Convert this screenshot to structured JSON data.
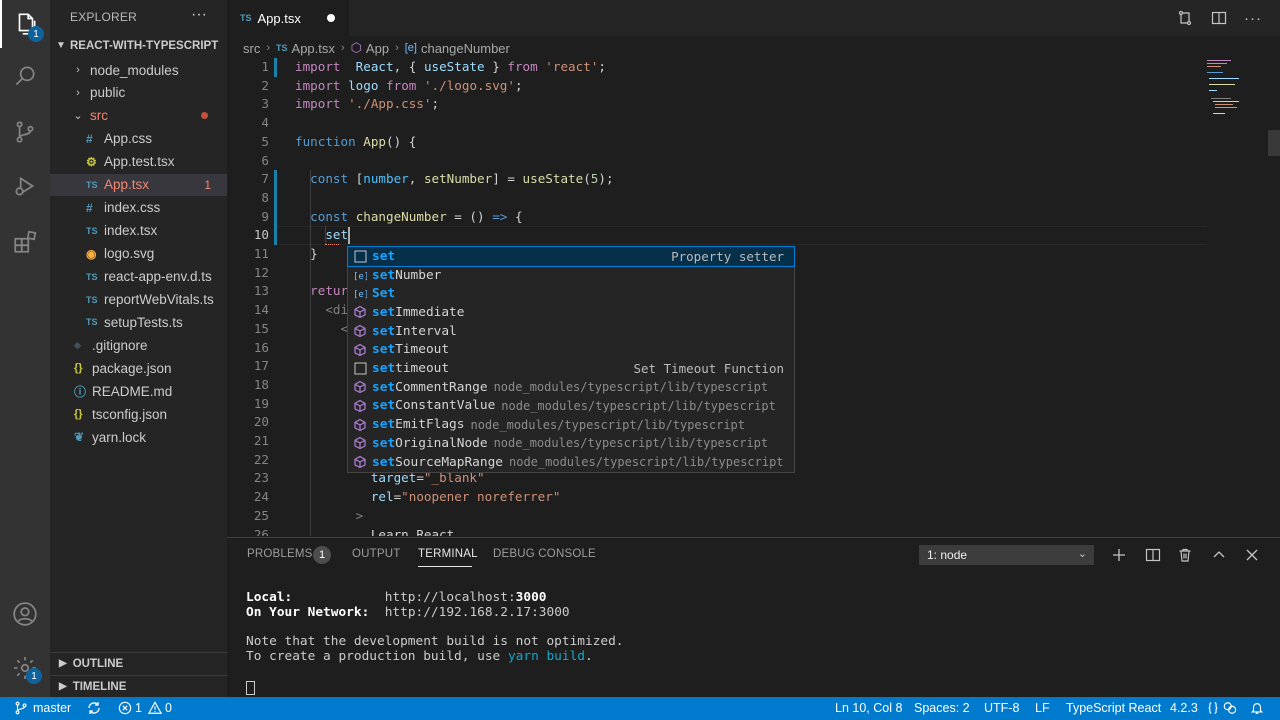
{
  "activity_bar": {
    "explorer_badge": "1",
    "settings_badge": "1"
  },
  "sidebar": {
    "title": "EXPLORER",
    "more": "···",
    "folder": "REACT-WITH-TYPESCRIPT",
    "items": [
      {
        "label": "node_modules",
        "type": "folder-closed",
        "color": "#cccccc"
      },
      {
        "label": "public",
        "type": "folder-closed",
        "color": "#cccccc"
      },
      {
        "label": "src",
        "type": "folder-open",
        "color": "#f48771"
      },
      {
        "label": "App.css",
        "type": "css"
      },
      {
        "label": "App.test.tsx",
        "type": "test"
      },
      {
        "label": "App.tsx",
        "type": "ts",
        "badge": "1",
        "color": "#f48771"
      },
      {
        "label": "index.css",
        "type": "css"
      },
      {
        "label": "index.tsx",
        "type": "ts"
      },
      {
        "label": "logo.svg",
        "type": "svg"
      },
      {
        "label": "react-app-env.d.ts",
        "type": "ts"
      },
      {
        "label": "reportWebVitals.ts",
        "type": "ts"
      },
      {
        "label": "setupTests.ts",
        "type": "ts"
      },
      {
        "label": ".gitignore",
        "type": "git"
      },
      {
        "label": "package.json",
        "type": "json"
      },
      {
        "label": "README.md",
        "type": "info"
      },
      {
        "label": "tsconfig.json",
        "type": "json"
      },
      {
        "label": "yarn.lock",
        "type": "yarn"
      }
    ],
    "ts_badge": "TS",
    "outline": "OUTLINE",
    "timeline": "TIMELINE"
  },
  "tab": {
    "prefix": "TS",
    "label": "App.tsx"
  },
  "breadcrumb": {
    "parts": [
      "src",
      "App.tsx",
      "App",
      "changeNumber"
    ],
    "ts": "TS"
  },
  "editor": {
    "current_line": 10,
    "lines": [
      {
        "n": "1",
        "tokens": [
          [
            "kw2",
            "import"
          ],
          [
            "",
            "  "
          ],
          [
            "var",
            "React"
          ],
          [
            "",
            ", { "
          ],
          [
            "var",
            "useState"
          ],
          [
            "",
            " } "
          ],
          [
            "kw2",
            "from"
          ],
          [
            "",
            " "
          ],
          [
            "str",
            "'react'"
          ],
          [
            "",
            ";"
          ]
        ]
      },
      {
        "n": "2",
        "tokens": [
          [
            "kw2",
            "import"
          ],
          [
            "",
            " "
          ],
          [
            "var",
            "logo"
          ],
          [
            "",
            " "
          ],
          [
            "kw2",
            "from"
          ],
          [
            "",
            " "
          ],
          [
            "str",
            "'./logo.svg'"
          ],
          [
            "",
            ";"
          ]
        ]
      },
      {
        "n": "3",
        "tokens": [
          [
            "kw2",
            "import"
          ],
          [
            "",
            " "
          ],
          [
            "str",
            "'./App.css'"
          ],
          [
            "",
            ";"
          ]
        ]
      },
      {
        "n": "4",
        "tokens": []
      },
      {
        "n": "5",
        "tokens": [
          [
            "kw",
            "function"
          ],
          [
            "",
            " "
          ],
          [
            "fn",
            "App"
          ],
          [
            "",
            "() {"
          ]
        ]
      },
      {
        "n": "6",
        "tokens": []
      },
      {
        "n": "7",
        "tokens": [
          [
            "",
            "  "
          ],
          [
            "kw",
            "const"
          ],
          [
            "",
            " ["
          ],
          [
            "cst",
            "number"
          ],
          [
            "",
            ", "
          ],
          [
            "fn",
            "setNumber"
          ],
          [
            "",
            "] = "
          ],
          [
            "fn",
            "useState"
          ],
          [
            "",
            "("
          ],
          [
            "num",
            "5"
          ],
          [
            "",
            ");"
          ]
        ]
      },
      {
        "n": "8",
        "tokens": []
      },
      {
        "n": "9",
        "tokens": [
          [
            "",
            "  "
          ],
          [
            "kw",
            "const"
          ],
          [
            "",
            " "
          ],
          [
            "fn",
            "changeNumber"
          ],
          [
            "",
            " = () "
          ],
          [
            "kw",
            "=>"
          ],
          [
            "",
            " {"
          ]
        ]
      },
      {
        "n": "10",
        "tokens": [
          [
            "",
            "    "
          ],
          [
            "var",
            "set"
          ]
        ]
      },
      {
        "n": "11",
        "tokens": [
          [
            "",
            "  }"
          ]
        ]
      },
      {
        "n": "12",
        "tokens": []
      },
      {
        "n": "13",
        "tokens": [
          [
            "",
            "  "
          ],
          [
            "kw2",
            "retur"
          ]
        ]
      },
      {
        "n": "14",
        "tokens": [
          [
            "",
            "    "
          ],
          [
            "tag",
            "<di"
          ]
        ]
      },
      {
        "n": "15",
        "tokens": [
          [
            "",
            "      "
          ],
          [
            "tag",
            "<"
          ]
        ]
      },
      {
        "n": "16",
        "tokens": []
      },
      {
        "n": "17",
        "tokens": []
      },
      {
        "n": "18",
        "tokens": []
      },
      {
        "n": "19",
        "tokens": []
      },
      {
        "n": "20",
        "tokens": []
      },
      {
        "n": "21",
        "tokens": []
      },
      {
        "n": "22",
        "tokens": []
      },
      {
        "n": "23",
        "tokens": [
          [
            "",
            "          "
          ],
          [
            "var",
            "target"
          ],
          [
            "",
            "="
          ],
          [
            "str",
            "\"_blank\""
          ]
        ]
      },
      {
        "n": "24",
        "tokens": [
          [
            "",
            "          "
          ],
          [
            "var",
            "rel"
          ],
          [
            "",
            "="
          ],
          [
            "str",
            "\"noopener noreferrer\""
          ]
        ]
      },
      {
        "n": "25",
        "tokens": [
          [
            "",
            "        "
          ],
          [
            "tag",
            ">"
          ]
        ]
      },
      {
        "n": "26",
        "tokens": [
          [
            "",
            "          Learn React"
          ]
        ]
      }
    ]
  },
  "suggest": {
    "items": [
      {
        "match": "set",
        "rest": "",
        "icon": "square",
        "right": "Property setter"
      },
      {
        "match": "set",
        "rest": "Number",
        "icon": "var"
      },
      {
        "match": "Set",
        "rest": "",
        "icon": "var"
      },
      {
        "match": "set",
        "rest": "Immediate",
        "icon": "cube"
      },
      {
        "match": "set",
        "rest": "Interval",
        "icon": "cube"
      },
      {
        "match": "set",
        "rest": "Timeout",
        "icon": "cube"
      },
      {
        "match": "set",
        "rest": "timeout",
        "icon": "square",
        "right": "Set Timeout Function"
      },
      {
        "match": "set",
        "rest": "CommentRange",
        "icon": "cube",
        "detail": "node_modules/typescript/lib/typescript"
      },
      {
        "match": "set",
        "rest": "ConstantValue",
        "icon": "cube",
        "detail": "node_modules/typescript/lib/typescript"
      },
      {
        "match": "set",
        "rest": "EmitFlags",
        "icon": "cube",
        "detail": "node_modules/typescript/lib/typescript"
      },
      {
        "match": "set",
        "rest": "OriginalNode",
        "icon": "cube",
        "detail": "node_modules/typescript/lib/typescript"
      },
      {
        "match": "set",
        "rest": "SourceMapRange",
        "icon": "cube",
        "detail": "node_modules/typescript/lib/typescript"
      }
    ]
  },
  "panel": {
    "tabs": {
      "problems": "PROBLEMS",
      "output": "OUTPUT",
      "terminal": "TERMINAL",
      "debug": "DEBUG CONSOLE"
    },
    "problems_count": "1",
    "terminal_select": "1: node",
    "terminal": {
      "local_label": "Local:",
      "local_url_prefix": "http://localhost:",
      "local_port": "3000",
      "network_label": "On Your Network:",
      "network_url": "http://192.168.2.17:3000",
      "note1": "Note that the development build is not optimized.",
      "note2_prefix": "To create a production build, use ",
      "note2_cmd": "yarn build",
      "note2_suffix": "."
    }
  },
  "statusbar": {
    "branch": "master",
    "errors": "1",
    "warnings": "0",
    "position": "Ln 10, Col 8",
    "spaces": "Spaces: 2",
    "encoding": "UTF-8",
    "eol": "LF",
    "language": "TypeScript React",
    "version": "4.2.3"
  },
  "colors": {
    "accent": "#007acc",
    "ts_blue": "#519aba",
    "error": "#f48771"
  }
}
